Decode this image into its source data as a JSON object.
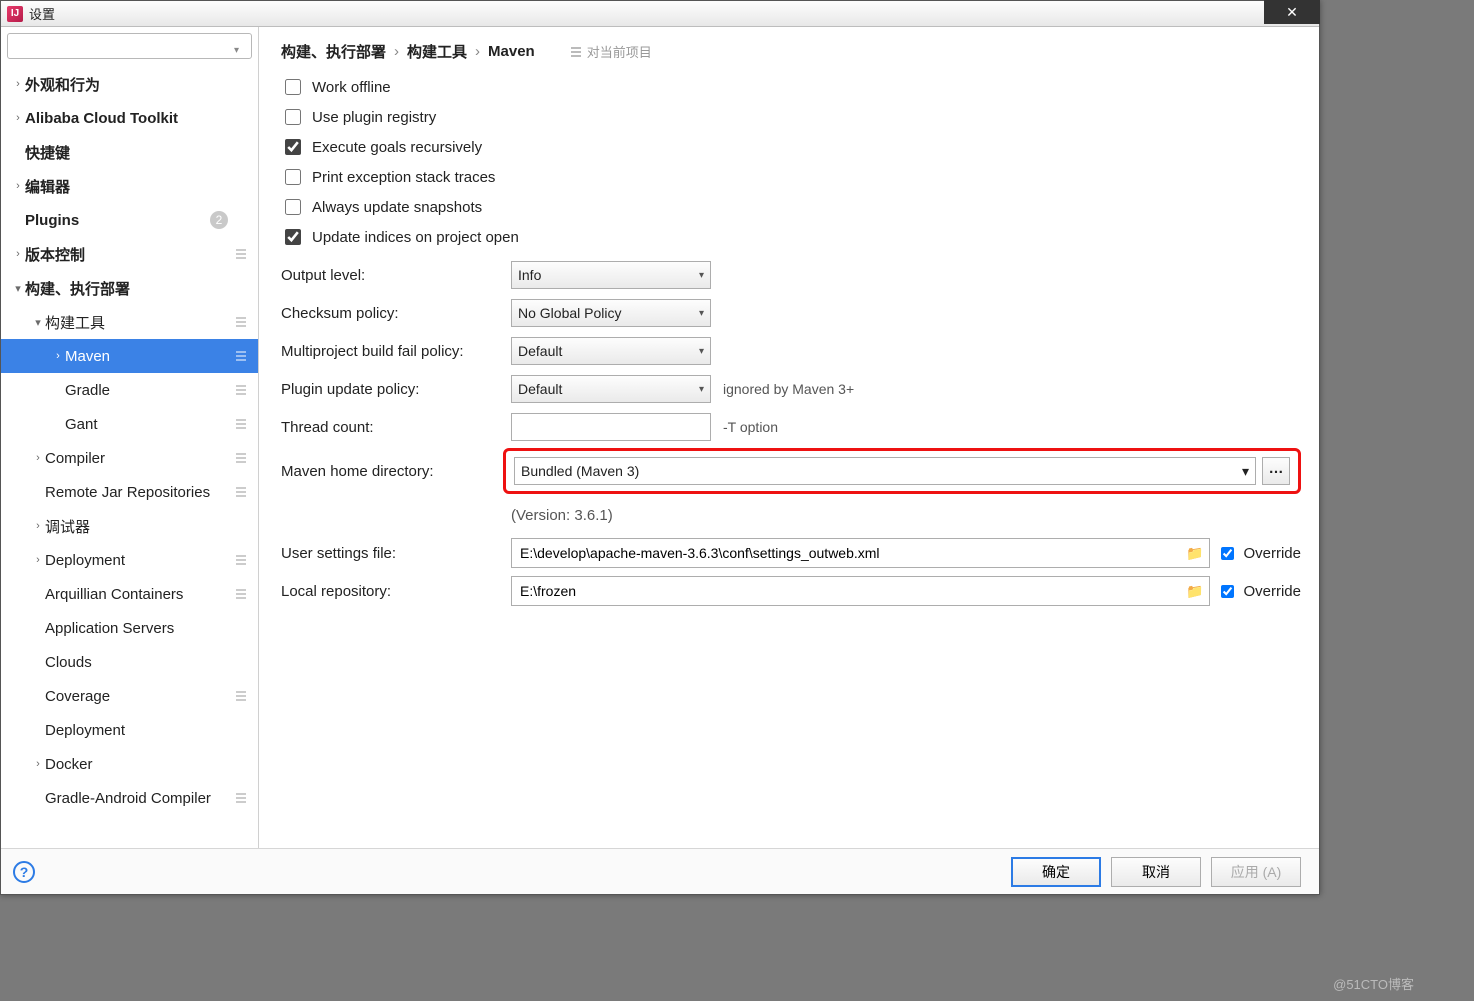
{
  "window": {
    "title": "设置"
  },
  "search": {
    "placeholder": ""
  },
  "sidebar": {
    "items": [
      {
        "label": "外观和行为",
        "expandable": true,
        "level": 0,
        "bold": true
      },
      {
        "label": "Alibaba Cloud Toolkit",
        "expandable": true,
        "level": 0,
        "bold": true
      },
      {
        "label": "快捷键",
        "expandable": false,
        "level": 0,
        "bold": true,
        "indentArrow": true
      },
      {
        "label": "编辑器",
        "expandable": true,
        "level": 0,
        "bold": true
      },
      {
        "label": "Plugins",
        "expandable": false,
        "level": 0,
        "bold": true,
        "badge": "2",
        "indentArrow": true
      },
      {
        "label": "版本控制",
        "expandable": true,
        "level": 0,
        "bold": true,
        "scope": true
      },
      {
        "label": "构建、执行部署",
        "expandable": true,
        "expanded": true,
        "level": 0,
        "bold": true
      },
      {
        "label": "构建工具",
        "expandable": true,
        "expanded": true,
        "level": 1,
        "scope": true
      },
      {
        "label": "Maven",
        "expandable": true,
        "level": 2,
        "selected": true,
        "scope": true
      },
      {
        "label": "Gradle",
        "expandable": false,
        "level": 2,
        "scope": true,
        "indentArrow": true
      },
      {
        "label": "Gant",
        "expandable": false,
        "level": 2,
        "scope": true,
        "indentArrow": true
      },
      {
        "label": "Compiler",
        "expandable": true,
        "level": 1,
        "scope": true
      },
      {
        "label": "Remote Jar Repositories",
        "expandable": false,
        "level": 1,
        "scope": true,
        "indentArrow": true
      },
      {
        "label": "调试器",
        "expandable": true,
        "level": 1
      },
      {
        "label": "Deployment",
        "expandable": true,
        "level": 1,
        "scope": true
      },
      {
        "label": "Arquillian Containers",
        "expandable": false,
        "level": 1,
        "scope": true,
        "indentArrow": true
      },
      {
        "label": "Application Servers",
        "expandable": false,
        "level": 1,
        "indentArrow": true
      },
      {
        "label": "Clouds",
        "expandable": false,
        "level": 1,
        "indentArrow": true
      },
      {
        "label": "Coverage",
        "expandable": false,
        "level": 1,
        "scope": true,
        "indentArrow": true
      },
      {
        "label": "Deployment",
        "expandable": false,
        "level": 1,
        "indentArrow": true
      },
      {
        "label": "Docker",
        "expandable": true,
        "level": 1
      },
      {
        "label": "Gradle-Android Compiler",
        "expandable": false,
        "level": 1,
        "scope": true,
        "indentArrow": true
      }
    ]
  },
  "breadcrumb": {
    "parts": [
      "构建、执行部署",
      "构建工具",
      "Maven"
    ],
    "current_project": "对当前项目"
  },
  "checks": {
    "work_offline": {
      "label": "Work offline",
      "checked": false
    },
    "use_registry": {
      "label": "Use plugin registry",
      "checked": false
    },
    "exec_recursive": {
      "label": "Execute goals recursively",
      "checked": true
    },
    "print_stack": {
      "label": "Print exception stack traces",
      "checked": false
    },
    "always_update": {
      "label": "Always update snapshots",
      "checked": false
    },
    "update_indices": {
      "label": "Update indices on project open",
      "checked": true
    }
  },
  "fields": {
    "output_level": {
      "label": "Output level:",
      "value": "Info"
    },
    "checksum": {
      "label": "Checksum policy:",
      "value": "No Global Policy"
    },
    "multiproject": {
      "label": "Multiproject build fail policy:",
      "value": "Default"
    },
    "plugin_update": {
      "label": "Plugin update policy:",
      "value": "Default",
      "hint": "ignored by Maven 3+"
    },
    "thread_count": {
      "label": "Thread count:",
      "value": "",
      "hint": "-T option"
    },
    "maven_home": {
      "label": "Maven home directory:",
      "value": "Bundled (Maven 3)",
      "version": "(Version: 3.6.1)"
    },
    "user_settings": {
      "label": "User settings file:",
      "value": "E:\\develop\\apache-maven-3.6.3\\conf\\settings_outweb.xml",
      "override_label": "Override",
      "override": true
    },
    "local_repo": {
      "label": "Local repository:",
      "value": "E:\\frozen",
      "override_label": "Override",
      "override": true
    }
  },
  "footer": {
    "ok": "确定",
    "cancel": "取消",
    "apply": "应用 (A)"
  },
  "watermark": "@51CTO博客"
}
